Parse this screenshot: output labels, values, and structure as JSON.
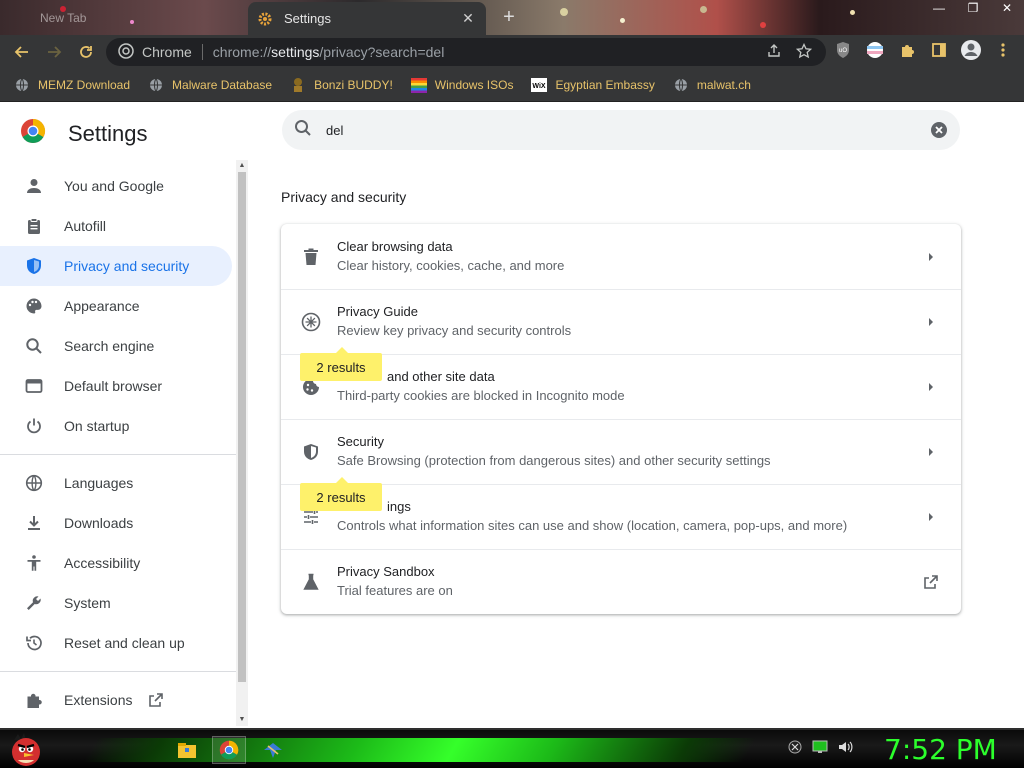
{
  "browser": {
    "tabs": [
      {
        "label": "New Tab",
        "active": false
      },
      {
        "label": "Settings",
        "active": true
      }
    ],
    "omnibox": {
      "scheme_label": "Chrome",
      "url_prefix": "chrome://",
      "url_host": "settings",
      "url_path": "/privacy?search=del"
    },
    "bookmarks": [
      {
        "label": "MEMZ Download",
        "icon": "globe-icon"
      },
      {
        "label": "Malware Database",
        "icon": "globe-icon"
      },
      {
        "label": "Bonzi BUDDY!",
        "icon": "bonzi-icon"
      },
      {
        "label": "Windows ISOs",
        "icon": "windows-flag-icon"
      },
      {
        "label": "Egyptian Embassy",
        "icon": "wix-icon"
      },
      {
        "label": "malwat.ch",
        "icon": "globe-icon"
      }
    ]
  },
  "settings": {
    "title": "Settings",
    "search_query": "del",
    "sidebar": [
      {
        "label": "You and Google",
        "icon": "person-icon"
      },
      {
        "label": "Autofill",
        "icon": "clipboard-icon"
      },
      {
        "label": "Privacy and security",
        "icon": "shield-icon",
        "active": true
      },
      {
        "label": "Appearance",
        "icon": "palette-icon"
      },
      {
        "label": "Search engine",
        "icon": "search-icon"
      },
      {
        "label": "Default browser",
        "icon": "browser-icon"
      },
      {
        "label": "On startup",
        "icon": "power-icon"
      },
      {
        "label": "Languages",
        "icon": "globe-icon"
      },
      {
        "label": "Downloads",
        "icon": "download-icon"
      },
      {
        "label": "Accessibility",
        "icon": "accessibility-icon"
      },
      {
        "label": "System",
        "icon": "wrench-icon"
      },
      {
        "label": "Reset and clean up",
        "icon": "history-icon"
      },
      {
        "label": "Extensions",
        "icon": "puzzle-icon"
      }
    ],
    "section_title": "Privacy and security",
    "rows": [
      {
        "title": "Clear browsing data",
        "subtitle": "Clear history, cookies, cache, and more",
        "icon": "trash-icon"
      },
      {
        "title": "Privacy Guide",
        "subtitle": "Review key privacy and security controls",
        "icon": "privacy-guide-icon"
      },
      {
        "title": "and other site data",
        "subtitle": "Third-party cookies are blocked in Incognito mode",
        "icon": "cookie-icon",
        "bubble": "2 results"
      },
      {
        "title": "Security",
        "subtitle": "Safe Browsing (protection from dangerous sites) and other security settings",
        "icon": "shield-half-icon"
      },
      {
        "title": "ings",
        "subtitle": "Controls what information sites can use and show (location, camera, pop-ups, and more)",
        "icon": "tune-icon",
        "bubble": "2 results"
      },
      {
        "title": "Privacy Sandbox",
        "subtitle": "Trial features are on",
        "icon": "flask-icon"
      }
    ]
  },
  "taskbar": {
    "clock": "7:52 PM"
  },
  "colors": {
    "accent": "#1a73e8",
    "active_nav_bg": "#e8f0fe",
    "highlight": "#fef16b",
    "clock": "#2cff2c"
  }
}
